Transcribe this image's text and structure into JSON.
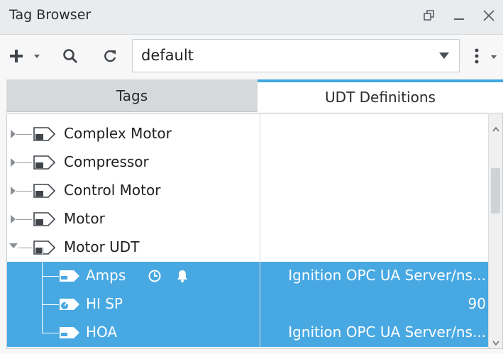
{
  "window": {
    "title": "Tag Browser"
  },
  "toolbar": {
    "provider_value": "default",
    "icons": [
      "plus-icon",
      "search-icon",
      "refresh-icon",
      "kebab-menu-icon"
    ]
  },
  "tabs": [
    {
      "label": "Tags",
      "active": false
    },
    {
      "label": "UDT Definitions",
      "active": true
    }
  ],
  "tree": {
    "items": [
      {
        "label": "Complex Motor",
        "type": "udt-definition",
        "expanded": false,
        "selected": false
      },
      {
        "label": "Compressor",
        "type": "udt-definition",
        "expanded": false,
        "selected": false
      },
      {
        "label": "Control Motor",
        "type": "udt-definition",
        "expanded": false,
        "selected": false
      },
      {
        "label": "Motor",
        "type": "udt-definition",
        "expanded": false,
        "selected": false
      },
      {
        "label": "Motor UDT",
        "type": "udt-definition",
        "expanded": true,
        "selected": false
      },
      {
        "label": "Amps",
        "type": "opc-tag",
        "selected": true,
        "value": "Ignition OPC UA Server/ns...",
        "badges": [
          "history-clock-icon",
          "alarm-bell-icon"
        ]
      },
      {
        "label": "HI SP",
        "type": "memory-tag",
        "selected": true,
        "value": "90"
      },
      {
        "label": "HOA",
        "type": "opc-tag",
        "selected": true,
        "value": "Ignition OPC UA Server/ns..."
      }
    ]
  },
  "colors": {
    "selection": "#48a8e2",
    "active_tab_accent": "#41a9e0",
    "titlebar": "#e9ecef"
  }
}
